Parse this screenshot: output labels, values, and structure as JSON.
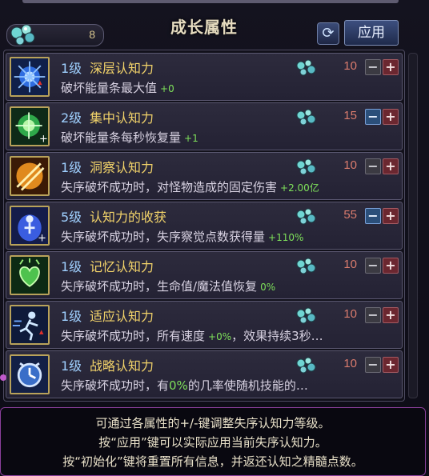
{
  "header": {
    "title": "成长属性",
    "points_value": "8",
    "points_icon": "crystal-gem-icon",
    "refresh_icon": "refresh-icon",
    "apply_label": "应用"
  },
  "skills": [
    {
      "level": "1级",
      "name": "深层认知力",
      "desc": "破坏能量条最大值",
      "bonus": "+0",
      "cost": "10",
      "minus_active": false,
      "icon": "blue-burst-icon",
      "level_color": "#9fd0ff"
    },
    {
      "level": "2级",
      "name": "集中认知力",
      "desc": "破坏能量条每秒恢复量",
      "bonus": "+1",
      "cost": "15",
      "minus_active": true,
      "icon": "green-orb-icon",
      "level_color": "#9fd0ff"
    },
    {
      "level": "1级",
      "name": "洞察认知力",
      "desc": "失序破坏成功时，对怪物造成的固定伤害",
      "bonus": "+2.00亿",
      "cost": "10",
      "minus_active": false,
      "icon": "orange-slash-icon",
      "level_color": "#9fd0ff"
    },
    {
      "level": "5级",
      "name": "认知力的收获",
      "desc": "失序破坏成功时，失序察觉点数获得量",
      "bonus": "+110%",
      "cost": "55",
      "minus_active": true,
      "icon": "blue-figure-icon",
      "level_color": "#9fd0ff"
    },
    {
      "level": "1级",
      "name": "记忆认知力",
      "desc": "失序破坏成功时，生命值/魔法值恢复",
      "bonus": "0%",
      "cost": "10",
      "minus_active": false,
      "icon": "green-heart-icon",
      "level_color": "#9fd0ff"
    },
    {
      "level": "1级",
      "name": "适应认知力",
      "desc": "失序破坏成功时，所有速度",
      "bonus": "+0%",
      "desc_tail": "，效果持续3秒…",
      "cost": "10",
      "minus_active": false,
      "icon": "runner-icon",
      "level_color": "#9fd0ff"
    },
    {
      "level": "1级",
      "name": "战略认知力",
      "desc_prefix": "失序破坏成功时，有",
      "bonus_inline": "0%",
      "desc_suffix": "的几率使随机技能的…",
      "cost": "10",
      "minus_active": false,
      "icon": "clock-icon",
      "level_color": "#9fd0ff"
    }
  ],
  "buttons": {
    "minus": "−",
    "plus": "+"
  },
  "notice": {
    "line1": "可通过各属性的+/-键调整失序认知力等级。",
    "line2": "按“应用”键可以实际应用当前失序认知力。",
    "line3": "按“初始化”键将重置所有信息，并返还认知之精髓点数。"
  },
  "colors": {
    "accent_gold": "#f2d36a",
    "bonus_green": "#7ee05a",
    "cost_red": "#d97b6d",
    "border_purple": "#8a3f9b"
  }
}
